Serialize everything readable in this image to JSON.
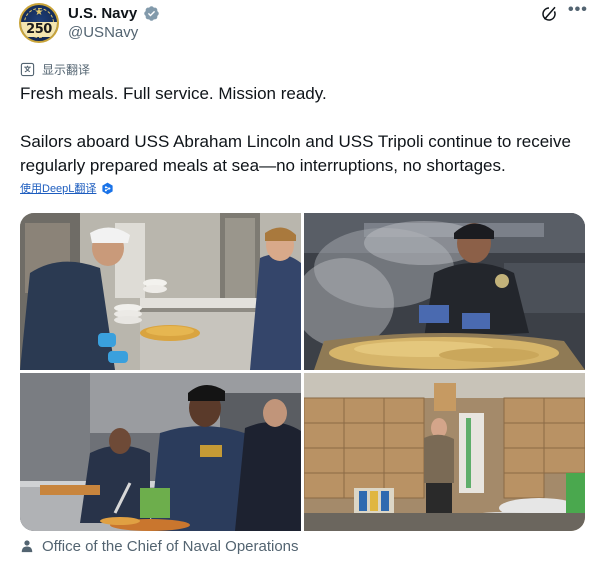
{
  "account": {
    "display_name": "U.S. Navy",
    "handle": "@USNavy",
    "avatar_text": "250",
    "avatar_icon": "navy-250-logo",
    "verified_icon": "verified-badge-icon",
    "verified_color": "#829aab"
  },
  "header_actions": {
    "grok_icon": "grok-icon",
    "more_icon": "more-icon",
    "more_label": "•••"
  },
  "translate": {
    "icon": "globe-translate-icon",
    "label": "显示翻译"
  },
  "tweet": {
    "line1": "Fresh meals. Full service. Mission ready.",
    "line2": "Sailors aboard USS Abraham Lincoln and USS Tripoli continue to receive regularly prepared meals at sea—no interruptions, no shortages."
  },
  "deepl": {
    "link_label": "使用DeepL翻译",
    "icon": "deepl-icon",
    "link_color": "#1d5dbf"
  },
  "media": {
    "photos": [
      {
        "name": "photo-galley-serving-line"
      },
      {
        "name": "photo-cooking-noodles-steam"
      },
      {
        "name": "photo-serving-food-line"
      },
      {
        "name": "photo-storeroom-boxes"
      }
    ]
  },
  "credit": {
    "icon": "person-icon",
    "text": "Office of the Chief of Naval Operations"
  },
  "colors": {
    "text_primary": "#0f1419",
    "text_secondary": "#536471"
  }
}
